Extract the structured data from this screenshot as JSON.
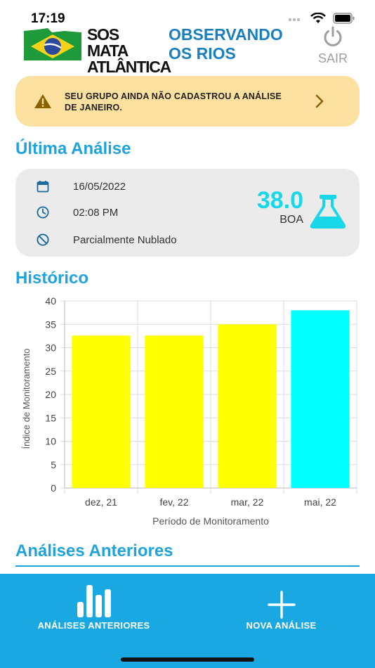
{
  "status_bar": {
    "time": "17:19"
  },
  "header": {
    "logo_line1": "SOS MATA",
    "logo_line2": "ATLÂNTICA",
    "title_line1": "OBSERVANDO",
    "title_line2": "OS RIOS",
    "logout_label": "SAIR"
  },
  "alert": {
    "line1": "SEU GRUPO AINDA NÃO CADASTROU A ANÁLISE",
    "line2": "DE JANEIRO.",
    "icon": "warning-icon"
  },
  "last_analysis": {
    "section_title": "Última Análise",
    "date": "16/05/2022",
    "time": "02:08 PM",
    "weather": "Parcialmente Nublado",
    "score": "38.0",
    "quality": "BOA"
  },
  "history": {
    "section_title": "Histórico"
  },
  "chart_data": {
    "type": "bar",
    "title": "",
    "categories": [
      "dez, 21",
      "fev, 22",
      "mar, 22",
      "mai, 22"
    ],
    "values": [
      32.6,
      32.6,
      35,
      38
    ],
    "colors": [
      "#ffff00",
      "#ffff00",
      "#ffff00",
      "#00ffff"
    ],
    "xlabel": "Período de Monitoramento",
    "ylabel": "Índice de Monitoramento",
    "ylim": [
      0,
      40
    ],
    "yticks": [
      "0",
      "5",
      "10",
      "15",
      "20",
      "25",
      "30",
      "35",
      "40"
    ],
    "grid": true
  },
  "previous": {
    "section_title": "Análises Anteriores"
  },
  "bottom_nav": {
    "previous_label": "ANÁLISES ANTERIORES",
    "new_label": "NOVA ANÁLISE"
  },
  "colors": {
    "accent": "#1fa3dc",
    "nav_bg": "#1aa8e3",
    "alert_bg": "#fbe0a0",
    "score": "#18d7e8"
  }
}
